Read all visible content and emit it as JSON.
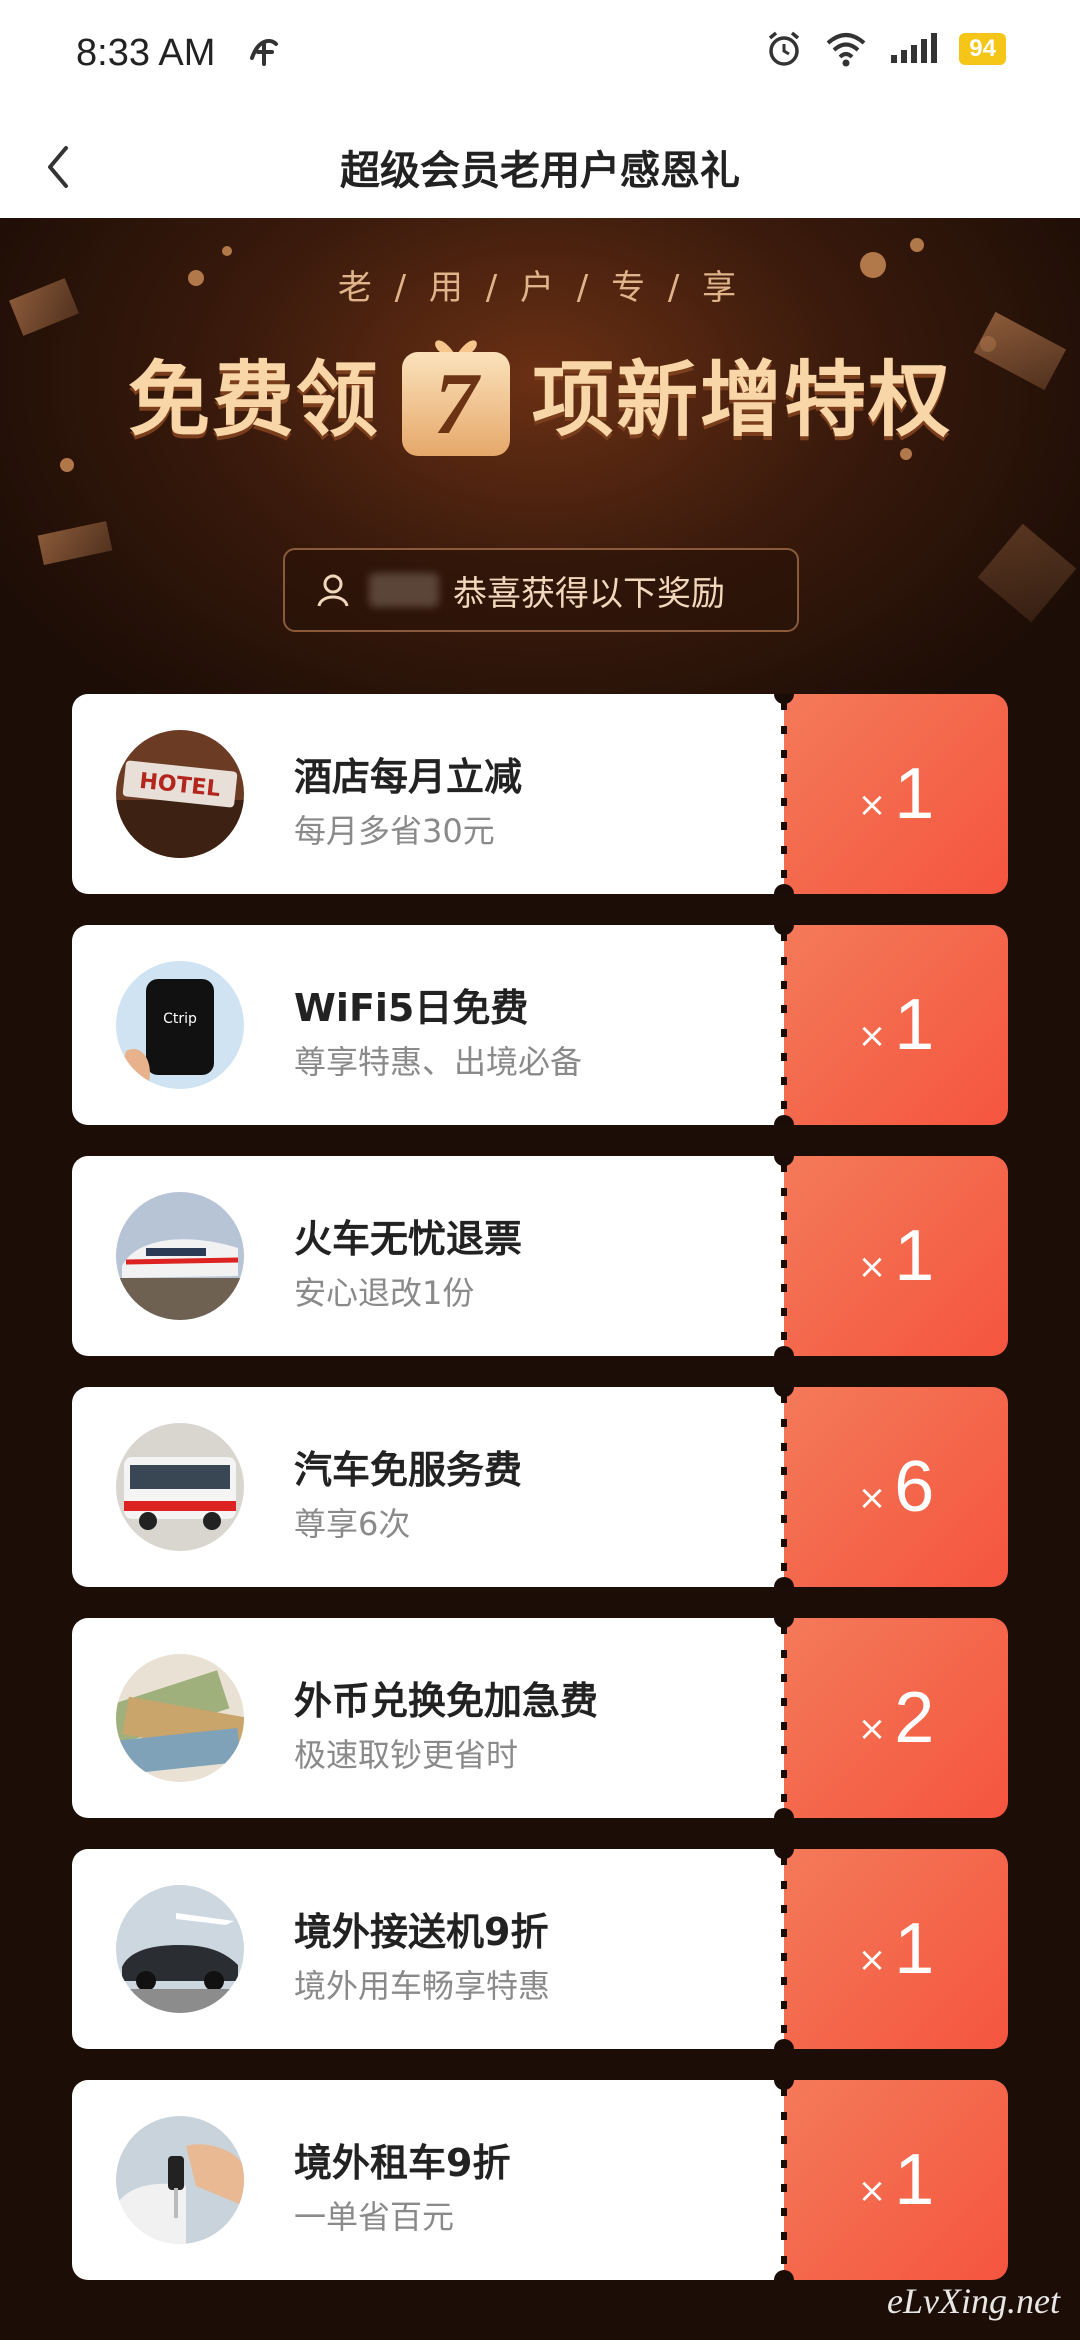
{
  "status_bar": {
    "time": "8:33 AM",
    "battery": "94"
  },
  "nav": {
    "title": "超级会员老用户感恩礼"
  },
  "hero": {
    "subtitle": "老 / 用 / 户 / 专 / 享",
    "heading_left": "免费领",
    "heading_number": "7",
    "heading_right": "项新增特权",
    "banner_text": "恭喜获得以下奖励"
  },
  "rewards": [
    {
      "title": "酒店每月立减",
      "desc": "每月多省30元",
      "x": "×",
      "qty": "1",
      "thumb": "hotel-sign"
    },
    {
      "title": "WiFi5日免费",
      "desc": "尊享特惠、出境必备",
      "x": "×",
      "qty": "1",
      "thumb": "wifi-device"
    },
    {
      "title": "火车无忧退票",
      "desc": "安心退改1份",
      "x": "×",
      "qty": "1",
      "thumb": "train"
    },
    {
      "title": "汽车免服务费",
      "desc": "尊享6次",
      "x": "×",
      "qty": "6",
      "thumb": "bus"
    },
    {
      "title": "外币兑换免加急费",
      "desc": "极速取钞更省时",
      "x": "×",
      "qty": "2",
      "thumb": "currency"
    },
    {
      "title": "境外接送机9折",
      "desc": "境外用车畅享特惠",
      "x": "×",
      "qty": "1",
      "thumb": "car-airport"
    },
    {
      "title": "境外租车9折",
      "desc": "一单省百元",
      "x": "×",
      "qty": "1",
      "thumb": "car-key"
    }
  ],
  "watermark": "eLvXing.net",
  "colors": {
    "accent": "#f5553e",
    "hero_text": "#f8d6a7",
    "background": "#1a0c06"
  }
}
